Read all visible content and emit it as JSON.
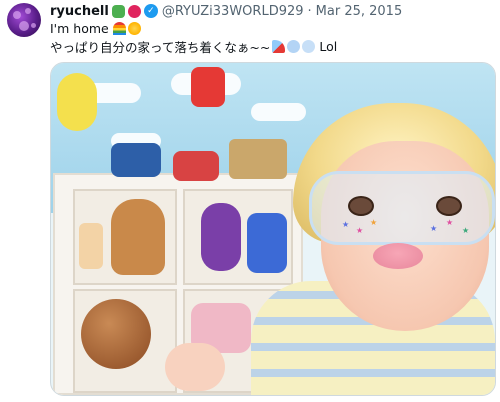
{
  "tweet": {
    "display_name": "ryuchell",
    "handle": "@RYUZi33WORLD929",
    "separator": "·",
    "date": "Mar 25, 2015",
    "line1_text": "I'm home",
    "line2_text": "やっぱり自分の家って落ち着くなぁ~~",
    "line2_suffix": "Lol",
    "icons": {
      "name_emoji_1": "dragon-emoji-icon",
      "name_emoji_2": "hearts-emoji-icon",
      "verified": "verified-badge-icon",
      "line1_emoji_1": "rainbow-emoji-icon",
      "line1_emoji_2": "sun-emoji-icon",
      "line2_emoji_1": "rocket-emoji-icon",
      "line2_emoji_2": "dash-emoji-icon",
      "line2_emoji_3": "dash-emoji-icon"
    },
    "colors": {
      "verified": "#1d9bf0",
      "handle": "#536471",
      "text": "#0f1419"
    }
  }
}
